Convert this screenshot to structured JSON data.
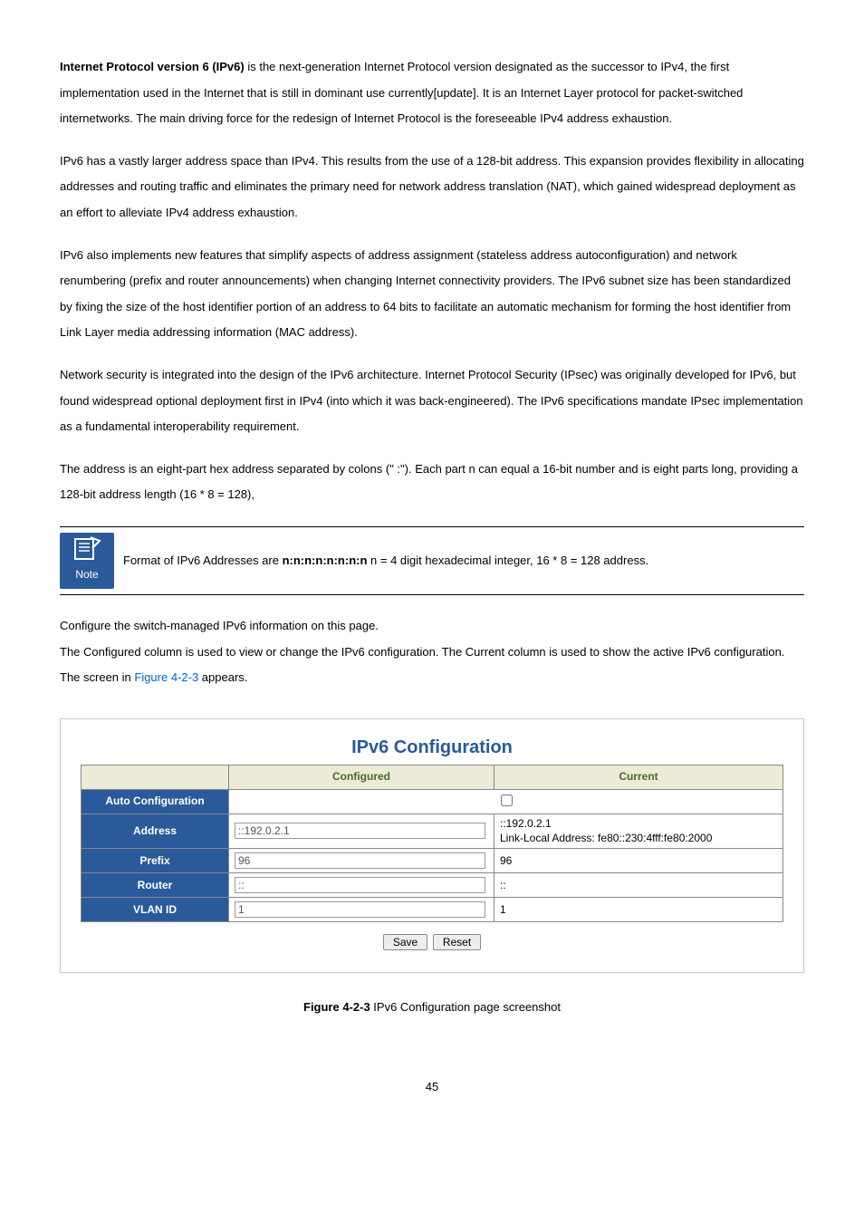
{
  "paragraphs": {
    "p1_lead": "Internet Protocol version 6 (IPv6)",
    "p1_rest": " is the next-generation Internet Protocol version designated as the successor to IPv4, the first implementation used in the Internet that is still in dominant use currently[update]. It is an Internet Layer protocol for packet-switched internetworks. The main driving force for the redesign of Internet Protocol is the foreseeable IPv4 address exhaustion.",
    "p2": "IPv6 has a vastly larger address space than IPv4. This results from the use of a 128-bit address. This expansion provides flexibility in allocating addresses and routing traffic and eliminates the primary need for network address translation (NAT), which gained widespread deployment as an effort to alleviate IPv4 address exhaustion.",
    "p3": "IPv6 also implements new features that simplify aspects of address assignment (stateless address autoconfiguration) and network renumbering (prefix and router announcements) when changing Internet connectivity providers. The IPv6 subnet size has been standardized by fixing the size of the host identifier portion of an address to 64 bits to facilitate an automatic mechanism for forming the host identifier from Link Layer media addressing information (MAC address).",
    "p4": "Network security is integrated into the design of the IPv6 architecture. Internet Protocol Security (IPsec) was originally developed for IPv6, but found widespread optional deployment first in IPv4 (into which it was back-engineered). The IPv6 specifications mandate IPsec implementation as a fundamental interoperability requirement.",
    "p5": "The address is an eight-part hex address separated by colons (\" :\"). Each part n can equal a 16-bit number and is eight parts long, providing a 128-bit address length (16 * 8 = 128),"
  },
  "note": {
    "icon_label": "Note",
    "pre": "Format of IPv6 Addresses are ",
    "bold": "n:n:n:n:n:n:n:n",
    "post": " n = 4 digit hexadecimal integer, 16 * 8 = 128 address."
  },
  "intro2": {
    "line1": "Configure the switch-managed IPv6 information on this page.",
    "line2_pre": "The Configured column is used to view or change the IPv6 configuration. The Current column is used to show the active IPv6 configuration. The screen in ",
    "line2_link": "Figure 4-2-3",
    "line2_post": " appears."
  },
  "config": {
    "title": "IPv6 Configuration",
    "headers": {
      "configured": "Configured",
      "current": "Current"
    },
    "rows": {
      "auto": {
        "label": "Auto Configuration",
        "checked": false
      },
      "address": {
        "label": "Address",
        "cfg": "::192.0.2.1",
        "cur_line1": "::192.0.2.1",
        "cur_line2": "Link-Local Address: fe80::230:4fff:fe80:2000"
      },
      "prefix": {
        "label": "Prefix",
        "cfg": "96",
        "cur": "96"
      },
      "router": {
        "label": "Router",
        "cfg": "::",
        "cur": "::"
      },
      "vlan": {
        "label": "VLAN ID",
        "cfg": "1",
        "cur": "1"
      }
    },
    "buttons": {
      "save": "Save",
      "reset": "Reset"
    }
  },
  "caption": {
    "bold": "Figure 4-2-3",
    "rest": " IPv6 Configuration page screenshot"
  },
  "page_number": "45"
}
